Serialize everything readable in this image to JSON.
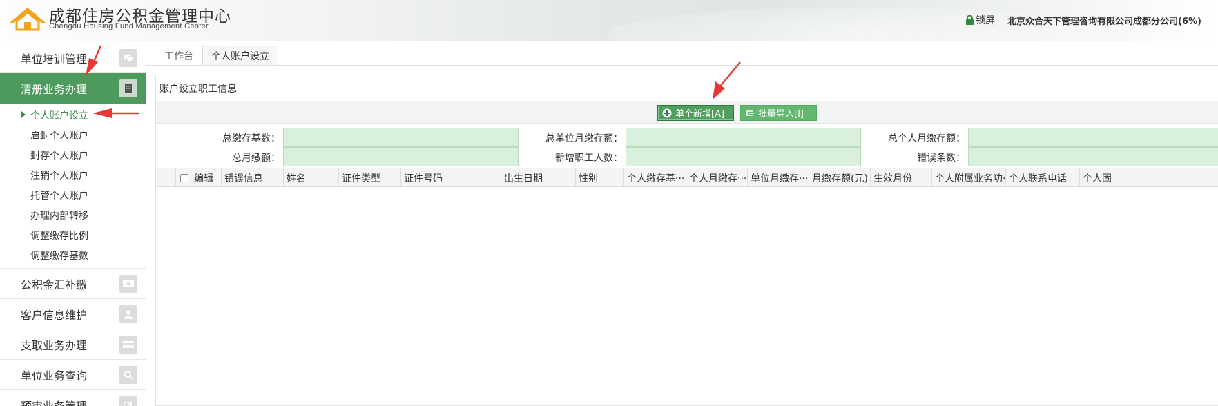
{
  "header": {
    "title": "成都住房公积金管理中心",
    "subtitle": "Chengdu  Housing Fund Management Center",
    "lock_label": "锁屏",
    "org_info": "北京众合天下管理咨询有限公司成都分公司(6%)"
  },
  "sidebar": {
    "items": [
      {
        "label": "单位培训管理",
        "icon": "chat-icon"
      },
      {
        "label": "清册业务办理",
        "icon": "book-icon",
        "active": true
      },
      {
        "label": "公积金汇补缴",
        "icon": "money-icon"
      },
      {
        "label": "客户信息维护",
        "icon": "user-icon"
      },
      {
        "label": "支取业务办理",
        "icon": "card-icon"
      },
      {
        "label": "单位业务查询",
        "icon": "search-icon"
      },
      {
        "label": "预审业务管理",
        "icon": "edit-icon"
      }
    ],
    "submenu": [
      "个人账户设立",
      "启封个人账户",
      "封存个人账户",
      "注销个人账户",
      "托管个人账户",
      "办理内部转移",
      "调整缴存比例",
      "调整缴存基数"
    ]
  },
  "tabs": [
    "工作台",
    "个人账户设立"
  ],
  "panel": {
    "title": "账户设立职工信息",
    "toolbar": {
      "add_label": "单个新增[A]",
      "import_label": "批量导入[I]"
    },
    "summary": {
      "row1": [
        "总缴存基数：",
        "总单位月缴存额：",
        "总个人月缴存额："
      ],
      "row2": [
        "总月缴额：",
        "新增职工人数：",
        "错误条数："
      ]
    },
    "columns": [
      "编辑",
      "错误信息",
      "姓名",
      "证件类型",
      "证件号码",
      "出生日期",
      "性别",
      "个人缴存基···",
      "个人月缴存···",
      "单位月缴存···",
      "月缴存额(元)",
      "生效月份",
      "个人附属业务功···",
      "个人联系电话",
      "个人固"
    ]
  },
  "colors": {
    "accent_green": "#4e9a5c",
    "field_green": "#d9f0dd",
    "annotation_red": "#e53935"
  }
}
